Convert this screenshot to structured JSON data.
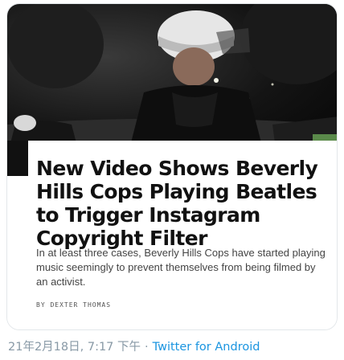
{
  "tweet_card": {
    "headline": "New Video Shows Beverly Hills Cops Playing Beatles to Trigger Instagram Copyright Filter",
    "dek": "In at least three cases, Beverly Hills Cops have started playing music seemingly to prevent themselves from being filmed by an activist.",
    "byline": "BY DEXTER THOMAS"
  },
  "tweet_meta": {
    "timestamp": "21年2月18日, 7:17 下午",
    "separator": "·",
    "source_app": "Twitter for Android"
  },
  "colors": {
    "meta_gray": "#8899a6",
    "link_blue": "#1b95e0",
    "headline": "#111111"
  }
}
